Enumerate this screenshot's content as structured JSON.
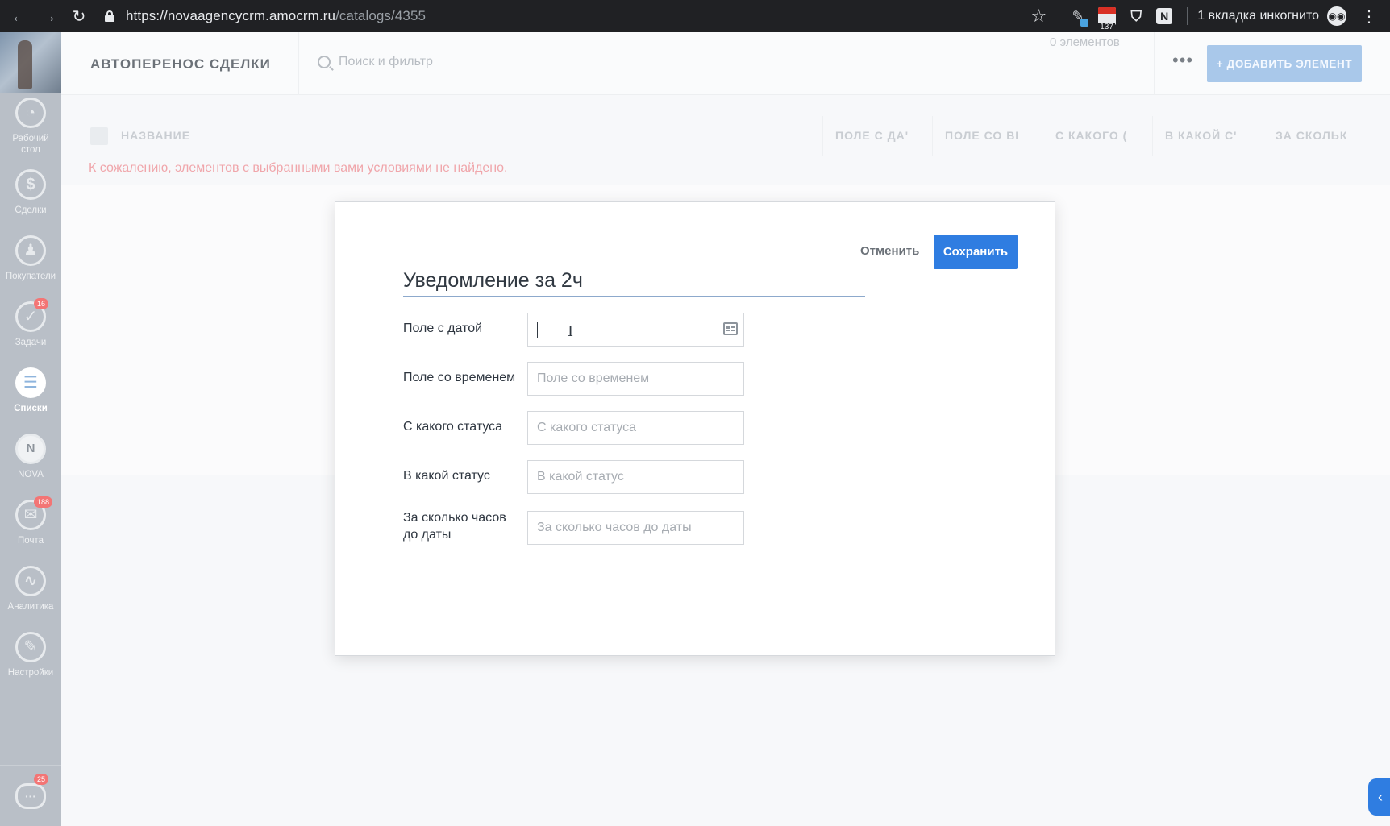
{
  "browser": {
    "url_host": "https://novaagencycrm.amocrm.ru",
    "url_path": "/catalogs/4355",
    "incognito_label": "1 вкладка инкогнито",
    "calendar_badge": "137",
    "n_extension": "N"
  },
  "sidebar": {
    "items": [
      {
        "label": "Рабочий стол",
        "icon": "dashboard-icon",
        "glyph": "◔"
      },
      {
        "label": "Сделки",
        "icon": "dollar-icon",
        "glyph": "$"
      },
      {
        "label": "Покупатели",
        "icon": "customers-icon",
        "glyph": "♟"
      },
      {
        "label": "Задачи",
        "icon": "tasks-icon",
        "glyph": "✓",
        "badge": "16"
      },
      {
        "label": "Списки",
        "icon": "lists-icon",
        "glyph": "☰",
        "active": true
      },
      {
        "label": "NOVA",
        "icon": "nova-icon",
        "glyph": "N"
      },
      {
        "label": "Почта",
        "icon": "mail-icon",
        "glyph": "✉",
        "badge": "188"
      },
      {
        "label": "Аналитика",
        "icon": "analytics-icon",
        "glyph": "∿"
      },
      {
        "label": "Настройки",
        "icon": "settings-icon",
        "glyph": "✎"
      }
    ],
    "chat_badge": "25"
  },
  "header": {
    "title": "АВТОПЕРЕНОС СДЕЛКИ",
    "search_placeholder": "Поиск и фильтр",
    "count": "0 элементов",
    "more": "•••",
    "add_button": "+ ДОБАВИТЬ ЭЛЕМЕНТ"
  },
  "table": {
    "columns": [
      "НАЗВАНИЕ",
      "ПОЛЕ С ДА'",
      "ПОЛЕ СО ВІ",
      "С КАКОГО (",
      "В КАКОЙ С'",
      "ЗА СКОЛЬК"
    ],
    "empty_message": "К сожалению, элементов с выбранными вами условиями не найдено."
  },
  "modal": {
    "cancel": "Отменить",
    "save": "Сохранить",
    "name_value": "Уведомление за 2ч",
    "fields": [
      {
        "label": "Поле с датой",
        "value": "",
        "placeholder": ""
      },
      {
        "label": "Поле со временем",
        "value": "",
        "placeholder": "Поле со временем"
      },
      {
        "label": "С какого статуса",
        "value": "",
        "placeholder": "С какого статуса"
      },
      {
        "label": "В какой статус",
        "value": "",
        "placeholder": "В какой статус"
      },
      {
        "label": "За сколько часов до даты",
        "value": "",
        "placeholder": "За сколько часов до даты"
      }
    ]
  },
  "colors": {
    "primary": "#2f7de1",
    "empty_message": "#f0a6ab",
    "badge": "#f37575"
  }
}
